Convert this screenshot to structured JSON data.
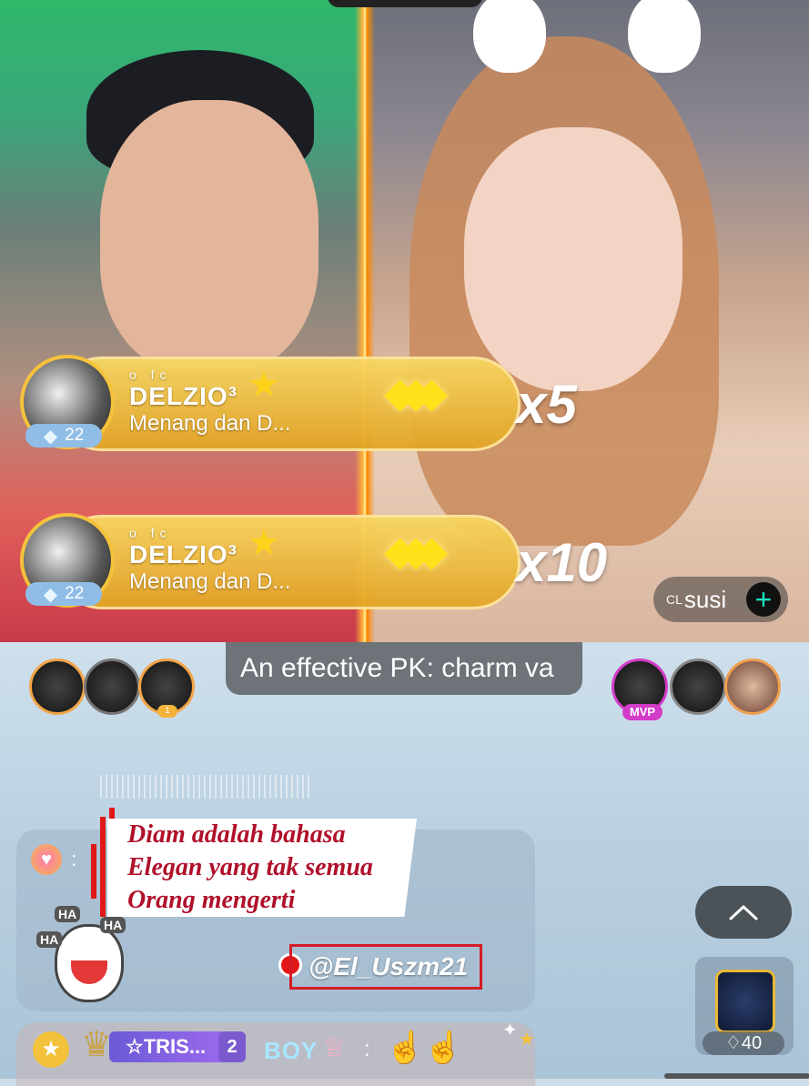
{
  "pk": {
    "left_host_video": "left-host-video",
    "right_host_video": "right-host-video",
    "right_host_name": "susi",
    "right_host_prefix": "CL",
    "charm_banner": "An effective PK: charm va"
  },
  "gifts": [
    {
      "sender": "DELZIO³",
      "sender_super": "o  fc",
      "level": "22",
      "message": "Menang dan D...",
      "count": "x5"
    },
    {
      "sender": "DELZIO³",
      "sender_super": "o  fc",
      "level": "22",
      "message": "Menang dan D...",
      "count": "x10"
    }
  ],
  "top_supporters": {
    "left_badge": "1",
    "right_mvp": "MVP"
  },
  "chat": {
    "quote_lines": [
      "Diam adalah bahasa",
      "Elegan yang tak semua",
      "Orang mengerti"
    ],
    "tag": "@El_Uszm21",
    "second": {
      "name": "☆TRIS...",
      "level": "2",
      "text": "BOY",
      "separator": ":",
      "colon": ":"
    }
  },
  "side": {
    "game_count": "40"
  },
  "colors": {
    "gift_gold": "#f8d762",
    "accent_teal": "#19e3c0",
    "quote_red": "#b0102a"
  },
  "icons": [
    "diamond-icon",
    "star-icon",
    "plus-icon",
    "heart-icon",
    "chevron-up-icon",
    "crown-icon",
    "hand-icon"
  ]
}
